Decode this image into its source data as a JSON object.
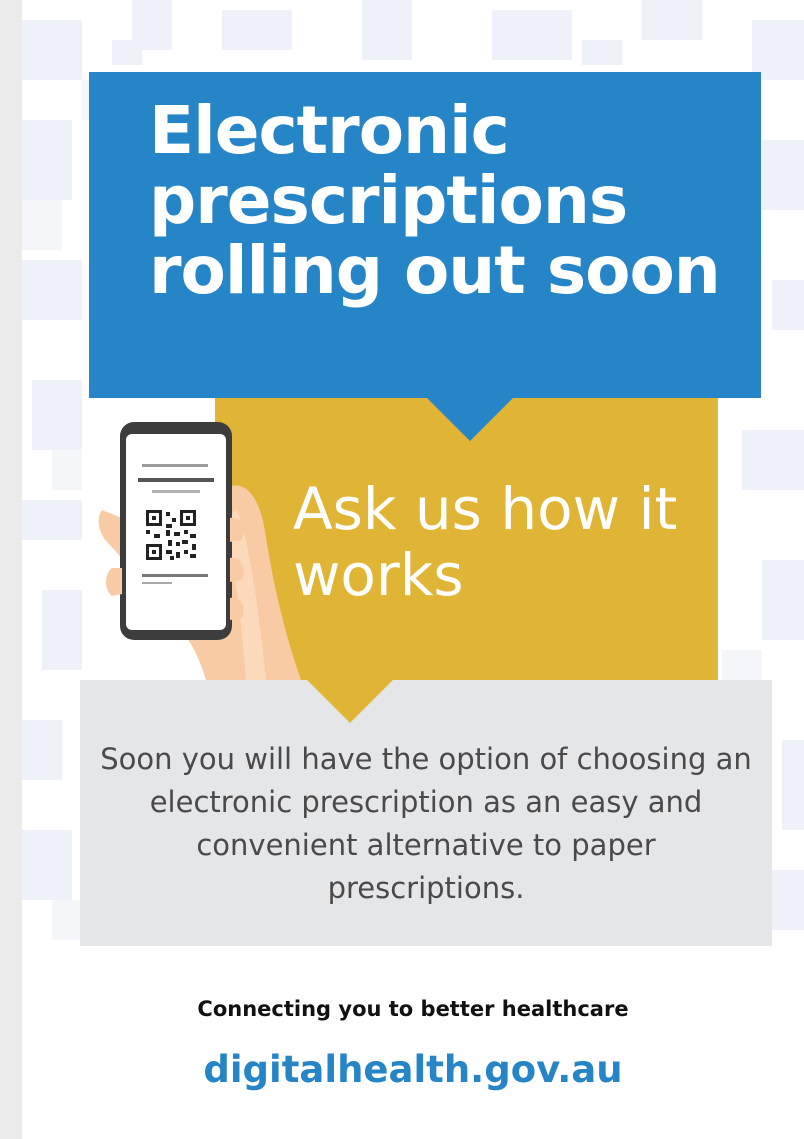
{
  "poster": {
    "headline": "Electronic prescriptions rolling out soon",
    "callout": "Ask us how it works",
    "body": "Soon you will have the option of choosing an electronic prescription as an easy and convenient alternative to paper prescriptions.",
    "tagline": "Connecting you to better healthcare",
    "website": "digitalhealth.gov.au"
  },
  "colors": {
    "blue": "#2585c7",
    "gold": "#e0b535",
    "grey_box": "#e5e6e8",
    "text_dark": "#4a4a4a"
  },
  "icons": {
    "illustration": "phone-with-qr-code-in-hand"
  }
}
